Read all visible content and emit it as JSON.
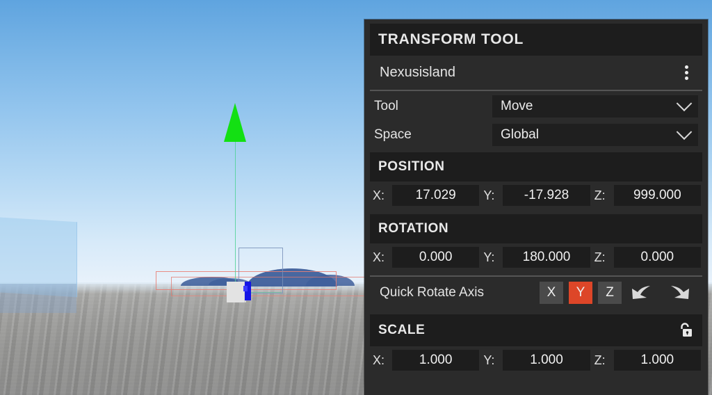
{
  "panel": {
    "title": "TRANSFORM TOOL",
    "object_name": "Nexusisland",
    "menu_icon": "kebab-menu-icon",
    "fields": [
      {
        "label": "Tool",
        "value": "Move",
        "icon": "chevron-down-icon"
      },
      {
        "label": "Space",
        "value": "Global",
        "icon": "chevron-down-icon"
      }
    ],
    "position": {
      "heading": "POSITION",
      "axes": [
        {
          "label": "X:",
          "value": "17.029"
        },
        {
          "label": "Y:",
          "value": "-17.928"
        },
        {
          "label": "Z:",
          "value": "999.000"
        }
      ]
    },
    "rotation": {
      "heading": "ROTATION",
      "axes": [
        {
          "label": "X:",
          "value": "0.000"
        },
        {
          "label": "Y:",
          "value": "180.000"
        },
        {
          "label": "Z:",
          "value": "0.000"
        }
      ],
      "quick_rotate": {
        "label": "Quick Rotate Axis",
        "buttons": [
          {
            "label": "X",
            "active": false
          },
          {
            "label": "Y",
            "active": true
          },
          {
            "label": "Z",
            "active": false
          }
        ],
        "ccw_icon": "rotate-counterclockwise-icon",
        "cw_icon": "rotate-clockwise-icon"
      }
    },
    "scale": {
      "heading": "SCALE",
      "lock_icon": "unlocked-padlock-icon",
      "axes": [
        {
          "label": "X:",
          "value": "1.000"
        },
        {
          "label": "Y:",
          "value": "1.000"
        },
        {
          "label": "Z:",
          "value": "1.000"
        }
      ]
    }
  },
  "viewport": {
    "scene_label": "3d-scene-viewport",
    "gizmo_y_axis_icon": "green-up-arrow-gizmo",
    "gizmo_z_axis_icon": "blue-axis-handle",
    "selected_object_icon": "white-cube"
  },
  "colors": {
    "accent": "#dd4628",
    "panel_bg": "#2b2b2b",
    "section_bg": "#1d1d1d",
    "input_bg": "#1d1d1d",
    "button_bg": "#4a4a4a",
    "gizmo_green": "#13e013",
    "gizmo_blue": "#1414e6",
    "wireframe_red": "#e88278"
  }
}
